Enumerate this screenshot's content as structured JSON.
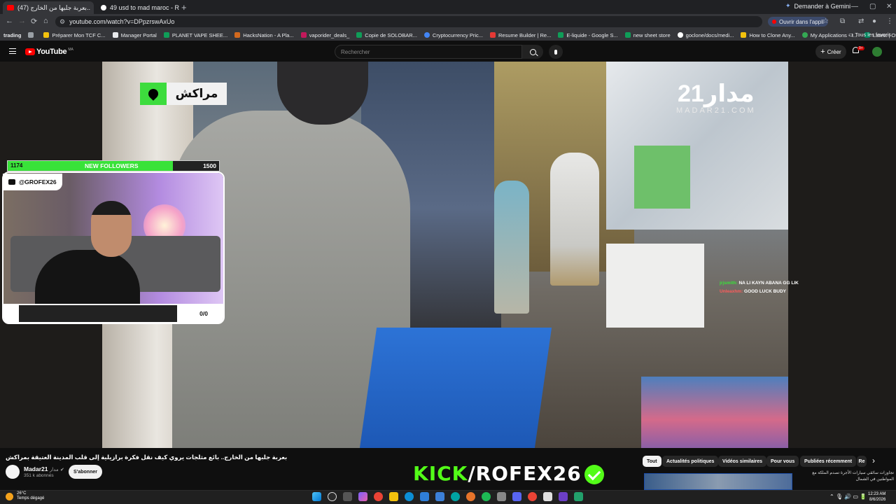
{
  "browser": {
    "tabs": [
      {
        "label": "(47) بعربة جلبها من الخارج..",
        "active": true
      },
      {
        "label": "49 usd to mad maroc - Recher",
        "active": false
      }
    ],
    "gemini_label": "Demander à Gemini",
    "url": "youtube.com/watch?v=DPpzrswAxUo",
    "open_app_label": "Ouvrir dans l'appli",
    "bookmarks": [
      "trading",
      "Préparer Mon TCF C...",
      "Manager Portal",
      "PLANET VAPE SHEE...",
      "HacksNation - A Pla...",
      "vaporider_deals_",
      "Copie de SOLOBAR...",
      "Cryptocurrency Pric...",
      "Resume Builder | Re...",
      "E-liquide - Google S...",
      "new sheet store",
      "goclone/docs/medi...",
      "How to Clone Any...",
      "My Applications - I...",
      "Latest | Official Play..."
    ],
    "all_favorites_label": "Tous les favoris"
  },
  "youtube": {
    "logo": "YouTube",
    "country": "MA",
    "search_placeholder": "Rechercher",
    "create_label": "Créer",
    "notif_count": "9+"
  },
  "overlay": {
    "location": "مراكش",
    "watermark_top": "21مدار",
    "watermark_bottom": "MADAR21.COM",
    "followers": {
      "current": "1174",
      "label": "NEW FOLLOWERS",
      "goal": "1500",
      "progress": 0.783
    },
    "cam_handle": "@GROFEX26",
    "cam_counter": "0/0",
    "chat": [
      {
        "user": "jrjsmith:",
        "message": "NA LI KAYN ABANA GG LIK"
      },
      {
        "user": "Unleaxhm:",
        "message": "GOOD LUCK BUDY"
      }
    ],
    "kick_left": "KICK",
    "kick_right": "/ROFEX26"
  },
  "video": {
    "title": "بعربة جلبها من الخارج.. بائع مثلجات يروي كيف نقل فكرة برازيلية إلى قلب المدينة العتيقة بمراكش",
    "channel": "Madar21",
    "channel_ar": "مدار",
    "subscribers": "351 k abonnés",
    "subscribe_label": "S'abonner"
  },
  "chips": [
    "Tout",
    "Actualités politiques",
    "Vidéos similaires",
    "Pour vous",
    "Publiées récemment",
    "Re"
  ],
  "related": {
    "title": "تجاوزات سائقي سيارات الأجرة تصدم الملكة مع المواطنين في الشمال"
  },
  "taskbar": {
    "temp": "26°C",
    "weather": "Temps dégagé",
    "time": "12:23 AM",
    "date": "8/6/2026"
  }
}
